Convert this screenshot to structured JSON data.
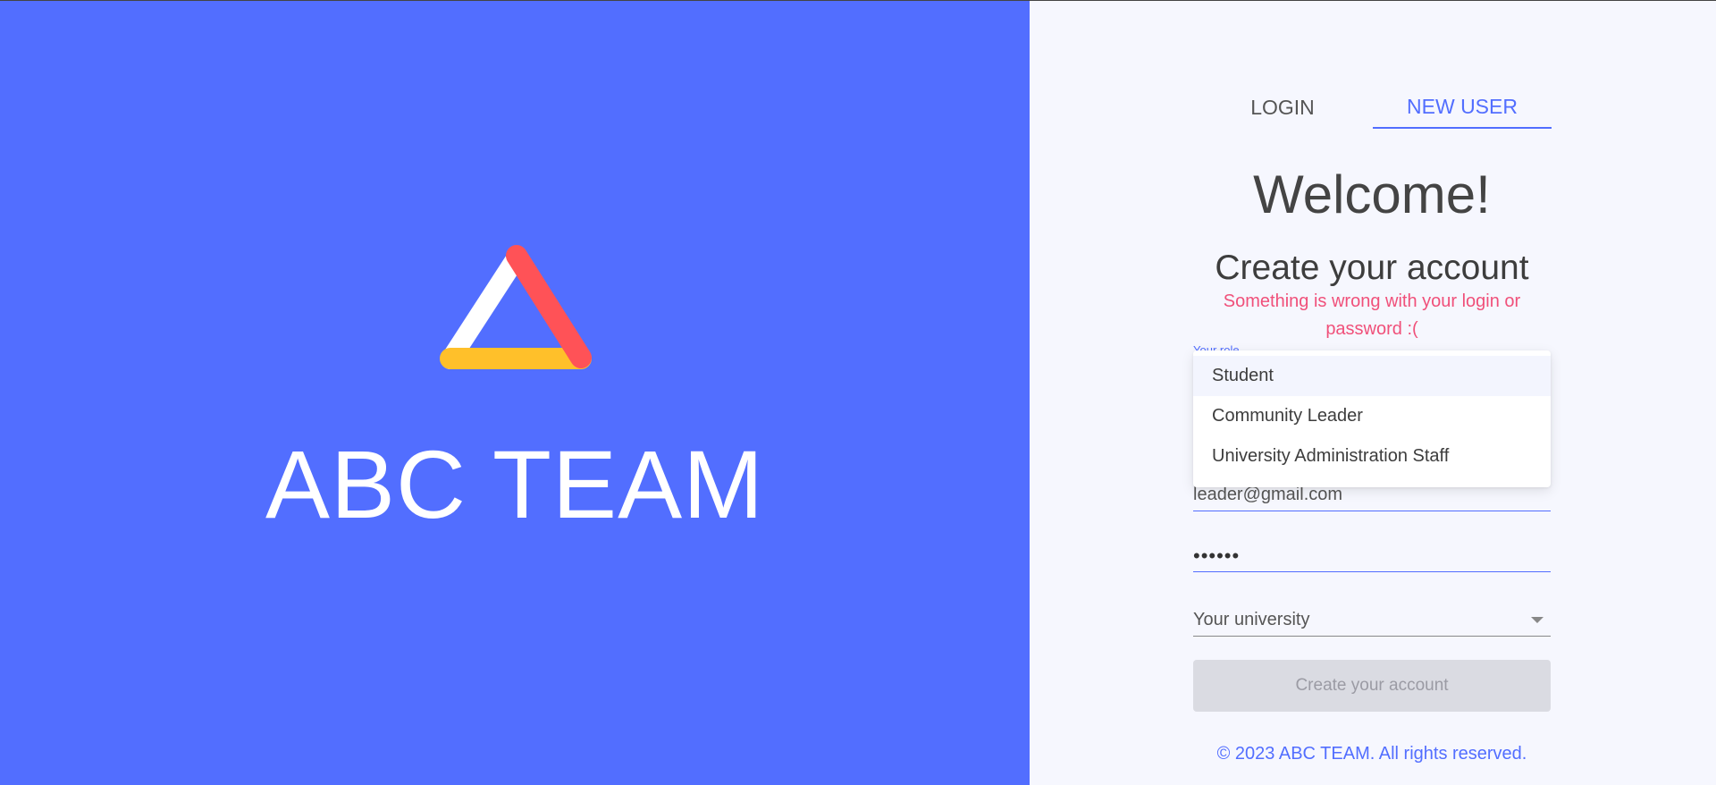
{
  "brand": {
    "title": "ABC TEAM",
    "logo_icon": "triangle-logo-icon",
    "colors": {
      "panel": "#526eff",
      "logo_left": "#ffffff",
      "logo_right": "#ff5257",
      "logo_bottom": "#ffc02a"
    }
  },
  "tabs": [
    {
      "label": "LOGIN",
      "active": false
    },
    {
      "label": "NEW USER",
      "active": true
    }
  ],
  "form": {
    "welcome": "Welcome!",
    "heading": "Create your account",
    "error": "Something is wrong with your login or password :(",
    "role_label": "Your role",
    "role_options": [
      "Student",
      "Community Leader",
      "University Administration Staff"
    ],
    "role_highlighted": "Student",
    "email_value": "leader@gmail.com",
    "password_value": "••••••",
    "university_placeholder": "Your university",
    "submit_label": "Create your account"
  },
  "footer": {
    "text": "© 2023 ABC TEAM. All rights reserved."
  },
  "accent_color": "#526eff",
  "error_color": "#f0507a"
}
